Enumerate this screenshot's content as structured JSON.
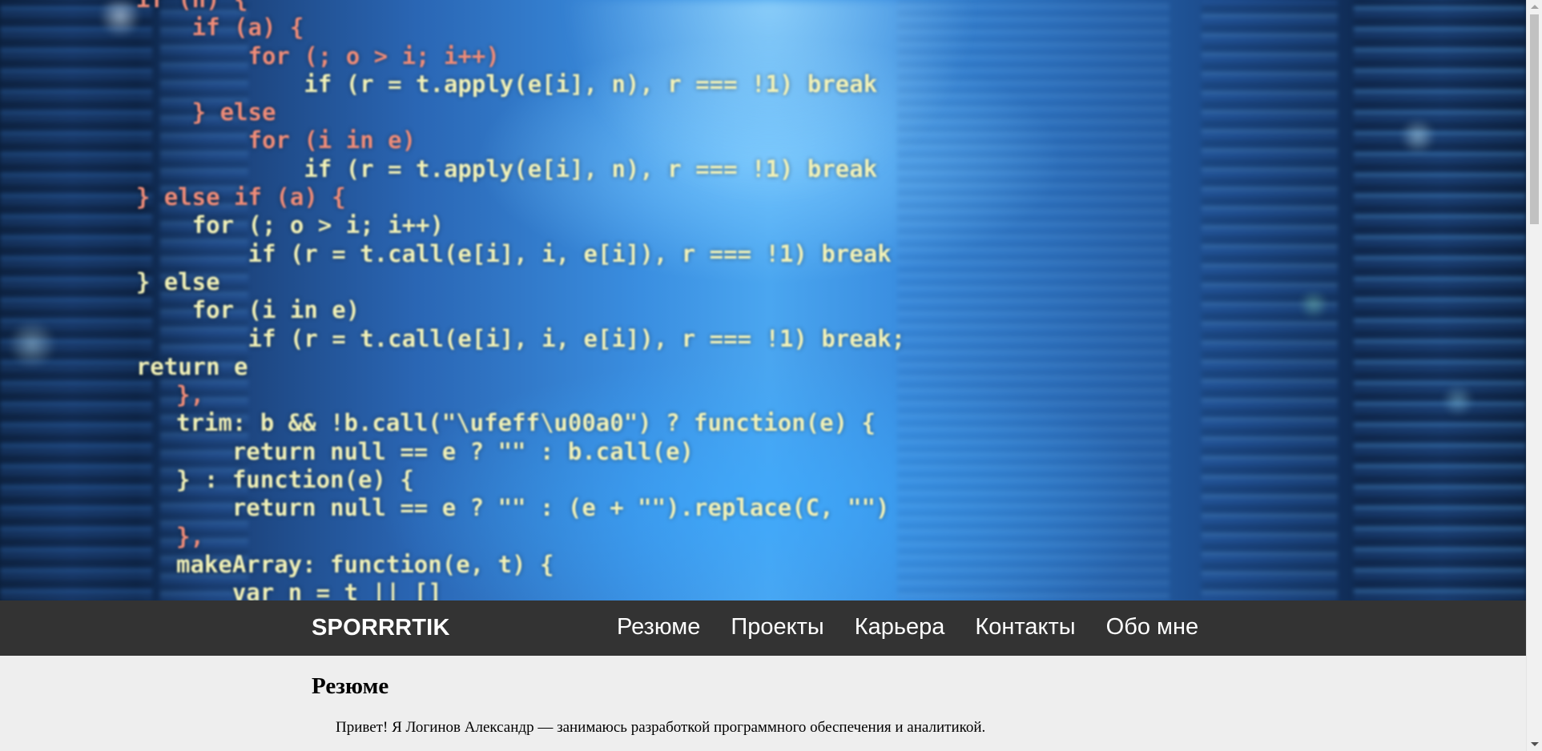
{
  "hero": {
    "code_lines": [
      "    if (n) {",
      "        if (a) {",
      "            for (; o > i; i++)",
      "                if (r = t.apply(e[i], n), r === !1) break",
      "        } else",
      "            for (i in e)",
      "                if (r = t.apply(e[i], n), r === !1) break",
      "    } else if (a) {",
      "        for (; o > i; i++)",
      "            if (r = t.call(e[i], i, e[i]), r === !1) break",
      "    } else",
      "        for (i in e)",
      "            if (r = t.call(e[i], i, e[i]), r === !1) break;",
      "    return e",
      "},",
      "trim: b && !b.call(\"\\ufeff\\u00a0\") ? function(e) {",
      "    return null == e ? \"\" : b.call(e)",
      "} : function(e) {",
      "    return null == e ? \"\" : (e + \"\").replace(C, \"\")",
      "},",
      "makeArray: function(e, t) {",
      "    var n = t || []"
    ]
  },
  "navbar": {
    "brand": "SPORRRTIK",
    "links": [
      "Резюме",
      "Проекты",
      "Карьера",
      "Контакты",
      "Обо мне"
    ]
  },
  "main": {
    "section_title": "Резюме",
    "intro": "Привет! Я Логинов Александр — занимаюсь разработкой программного обеспечения и аналитикой."
  },
  "colors": {
    "navbar_bg": "#333333",
    "page_bg": "#eeeeee",
    "nav_text": "#ffffff",
    "code_text": "#f2f2b8",
    "code_keyword": "#f08c78"
  }
}
